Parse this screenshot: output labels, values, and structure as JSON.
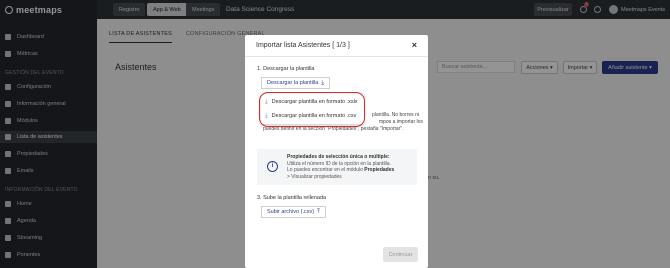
{
  "app": {
    "brand": "meetmaps"
  },
  "topbar": {
    "tabs": [
      "Registro",
      "App & Web",
      "Meetings"
    ],
    "active_tab": "App & Web",
    "project": "Data Science Congress",
    "preview": "Previsualizar",
    "notifications": "3",
    "user": "Meetmaps Events"
  },
  "sidebar": {
    "items_top": [
      "Dashboard",
      "Métricas"
    ],
    "section1": "GESTIÓN DEL EVENTO",
    "items_mid": [
      "Configuración",
      "Información general",
      "Módulos",
      "Lista de asistentes",
      "Propiedades",
      "Emails"
    ],
    "section2": "INFORMACIÓN DEL EVENTO",
    "items_bottom": [
      "Home",
      "Agenda",
      "Streaming",
      "Ponentes"
    ]
  },
  "main": {
    "subtabs": [
      "LISTA DE ASISTENTES",
      "CONFIGURACIÓN GENERAL"
    ],
    "title": "Asistentes",
    "search_placeholder": "Buscar asistente...",
    "actions": "Acciones",
    "import": "Importar",
    "add": "Añadir asistente",
    "empty_text": "con su."
  },
  "modal": {
    "title": "Importar lista Asistentes [ 1/3 ]",
    "close": "×",
    "step1": "1. Descargar la plantilla",
    "download_btn": "Descargar la plantilla",
    "dropdown": [
      "Descargar plantilla en formato .xslx",
      "Descargar plantilla en formato .csv"
    ],
    "para_partial_1": "plantilla. No borres ni",
    "para_partial_2": "mpos a importar los",
    "para_line3": "puedes definir en la sección \"Propiedades\", pestaña \"Importar\".",
    "info_title": "Propiedades de selección única o múltiple:",
    "info_line1": "Utiliza el número ID de la opción en la plantilla.",
    "info_line2_pre": "Lo puedes encontrar en el módulo ",
    "info_line2_bold": "Propiedades",
    "info_line3": "> Visualizar propiedades",
    "step3": "3. Sube la plantilla rellenada",
    "upload_btn": "Subir archivo (.csv)",
    "continue": "Continuar"
  }
}
